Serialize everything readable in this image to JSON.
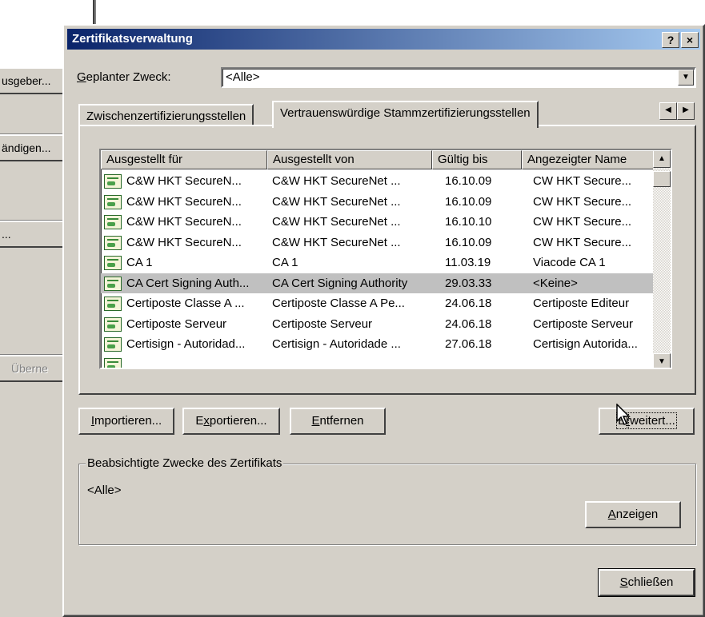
{
  "background_window": {
    "buttons": [
      "usgeber...",
      "ändigen...",
      "...",
      "Überne"
    ]
  },
  "dialog": {
    "title": "Zertifikatsverwaltung",
    "help_button": "?",
    "close_button": "×",
    "purpose_label_mnemonic": "G",
    "purpose_label_rest": "eplanter Zweck:",
    "purpose_value": "<Alle>",
    "tabs": [
      {
        "label": "Zwischenzertifizierungsstellen",
        "active": false
      },
      {
        "label": "Vertrauenswürdige Stammzertifizierungsstellen",
        "active": true
      }
    ],
    "columns": [
      "Ausgestellt für",
      "Ausgestellt von",
      "Gültig bis",
      "Angezeigter Name"
    ],
    "rows": [
      {
        "issued_to": "C&W HKT SecureN...",
        "issued_by": "C&W HKT SecureNet ...",
        "valid_to": "16.10.09",
        "friendly_name": "CW HKT Secure..."
      },
      {
        "issued_to": "C&W HKT SecureN...",
        "issued_by": "C&W HKT SecureNet ...",
        "valid_to": "16.10.09",
        "friendly_name": "CW HKT Secure..."
      },
      {
        "issued_to": "C&W HKT SecureN...",
        "issued_by": "C&W HKT SecureNet ...",
        "valid_to": "16.10.10",
        "friendly_name": "CW HKT Secure..."
      },
      {
        "issued_to": "C&W HKT SecureN...",
        "issued_by": "C&W HKT SecureNet ...",
        "valid_to": "16.10.09",
        "friendly_name": "CW HKT Secure..."
      },
      {
        "issued_to": "CA 1",
        "issued_by": "CA 1",
        "valid_to": "11.03.19",
        "friendly_name": "Viacode CA 1"
      },
      {
        "issued_to": "CA Cert Signing Auth...",
        "issued_by": "CA Cert Signing Authority",
        "valid_to": "29.03.33",
        "friendly_name": "<Keine>"
      },
      {
        "issued_to": "Certiposte Classe A ...",
        "issued_by": "Certiposte Classe A Pe...",
        "valid_to": "24.06.18",
        "friendly_name": "Certiposte Editeur"
      },
      {
        "issued_to": "Certiposte Serveur",
        "issued_by": "Certiposte Serveur",
        "valid_to": "24.06.18",
        "friendly_name": "Certiposte Serveur"
      },
      {
        "issued_to": "Certisign - Autoridad...",
        "issued_by": "Certisign - Autoridade ...",
        "valid_to": "27.06.18",
        "friendly_name": "Certisign Autorida..."
      }
    ],
    "selected_row_index": 5,
    "buttons": {
      "import": {
        "mnemonic": "I",
        "rest": "mportieren..."
      },
      "export": {
        "pre": "E",
        "mnemonic": "x",
        "rest": "portieren..."
      },
      "remove": {
        "mnemonic": "E",
        "rest": "ntfernen"
      },
      "advanced": {
        "pre": "E",
        "mnemonic": "r",
        "rest": "weitert..."
      },
      "view": {
        "mnemonic": "A",
        "rest": "nzeigen"
      },
      "close": {
        "mnemonic": "S",
        "rest": "chließen"
      }
    },
    "group_title": "Beabsichtigte Zwecke des Zertifikats",
    "group_value": "<Alle>"
  },
  "colors": {
    "face": "#d4d0c8",
    "title_start": "#0a246a",
    "title_end": "#a6caf0",
    "selection": "#c0c0c0"
  },
  "icons": [
    "help-icon",
    "close-icon",
    "chevron-down-icon",
    "chevron-up-icon",
    "arrow-left-icon",
    "arrow-right-icon",
    "certificate-icon",
    "mouse-cursor-icon"
  ]
}
